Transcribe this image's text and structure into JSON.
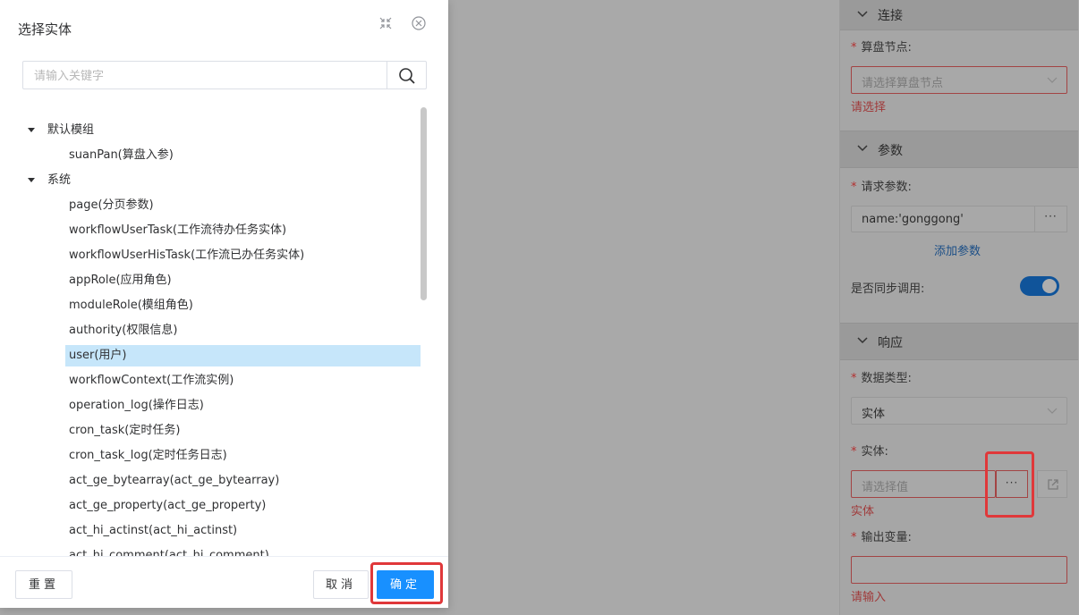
{
  "dialog": {
    "title": "选择实体",
    "search_placeholder": "请输入关键字",
    "tree": [
      {
        "type": "group",
        "label": "默认模组"
      },
      {
        "type": "leaf",
        "label": "suanPan(算盘入参)"
      },
      {
        "type": "group",
        "label": "系统"
      },
      {
        "type": "leaf",
        "label": "page(分页参数)"
      },
      {
        "type": "leaf",
        "label": "workflowUserTask(工作流待办任务实体)"
      },
      {
        "type": "leaf",
        "label": "workflowUserHisTask(工作流已办任务实体)"
      },
      {
        "type": "leaf",
        "label": "appRole(应用角色)"
      },
      {
        "type": "leaf",
        "label": "moduleRole(模组角色)"
      },
      {
        "type": "leaf",
        "label": "authority(权限信息)"
      },
      {
        "type": "leaf",
        "label": "user(用户)",
        "selected": true
      },
      {
        "type": "leaf",
        "label": "workflowContext(工作流实例)"
      },
      {
        "type": "leaf",
        "label": "operation_log(操作日志)"
      },
      {
        "type": "leaf",
        "label": "cron_task(定时任务)"
      },
      {
        "type": "leaf",
        "label": "cron_task_log(定时任务日志)"
      },
      {
        "type": "leaf",
        "label": "act_ge_bytearray(act_ge_bytearray)"
      },
      {
        "type": "leaf",
        "label": "act_ge_property(act_ge_property)"
      },
      {
        "type": "leaf",
        "label": "act_hi_actinst(act_hi_actinst)"
      },
      {
        "type": "leaf",
        "label": "act_hi_comment(act_hi_comment)"
      }
    ],
    "buttons": {
      "reset": "重置",
      "cancel": "取消",
      "confirm": "确定"
    }
  },
  "panel": {
    "connection": {
      "header": "连接",
      "node_label": "算盘节点:",
      "node_placeholder": "请选择算盘节点",
      "node_error": "请选择"
    },
    "params": {
      "header": "参数",
      "request_label": "请求参数:",
      "request_value": "name:'gonggong'",
      "more": "···",
      "add_link": "添加参数",
      "sync_label": "是否同步调用:",
      "sync_on": true
    },
    "response": {
      "header": "响应",
      "datatype_label": "数据类型:",
      "datatype_value": "实体",
      "entity_label": "实体:",
      "entity_placeholder": "请选择值",
      "entity_more": "···",
      "entity_error": "实体",
      "output_label": "输出变量:",
      "output_error": "请输入"
    }
  },
  "colors": {
    "primary": "#1890ff",
    "selected_row": "#c6e6fa",
    "highlight": "#e0383a",
    "error": "#a03a3a"
  }
}
